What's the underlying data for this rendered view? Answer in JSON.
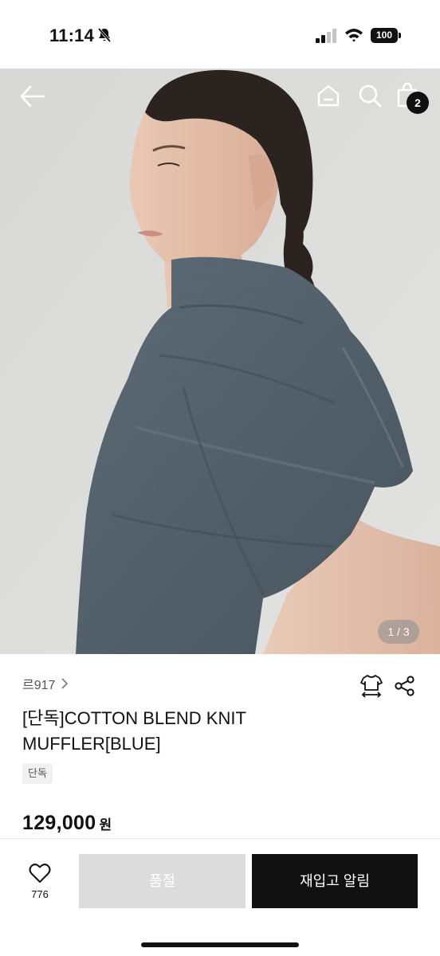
{
  "status_bar": {
    "time": "11:14",
    "battery": "100",
    "icons": [
      "bell-off-icon",
      "signal-icon",
      "wifi-icon",
      "battery-icon"
    ]
  },
  "header": {
    "icons": [
      "back-arrow-icon",
      "home-icon",
      "search-icon",
      "shopping-bag-icon"
    ],
    "bag_count": "2"
  },
  "gallery": {
    "page_indicator": "1 / 3",
    "current_page": 1,
    "total_pages": 3
  },
  "product": {
    "brand": "르917",
    "title": "[단독]COTTON BLEND KNIT MUFFLER[BLUE]",
    "badge": "단독",
    "price": "129,000",
    "price_unit": "원",
    "action_icons": [
      "size-guide-icon",
      "share-icon"
    ]
  },
  "bottom_bar": {
    "like_count": "776",
    "soldout_label": "품절",
    "restock_label": "재입고 알림"
  },
  "colors": {
    "background": "#ffffff",
    "primary_button": "#111111",
    "disabled_button": "#dcdcdc",
    "muffler": "#56646f"
  }
}
